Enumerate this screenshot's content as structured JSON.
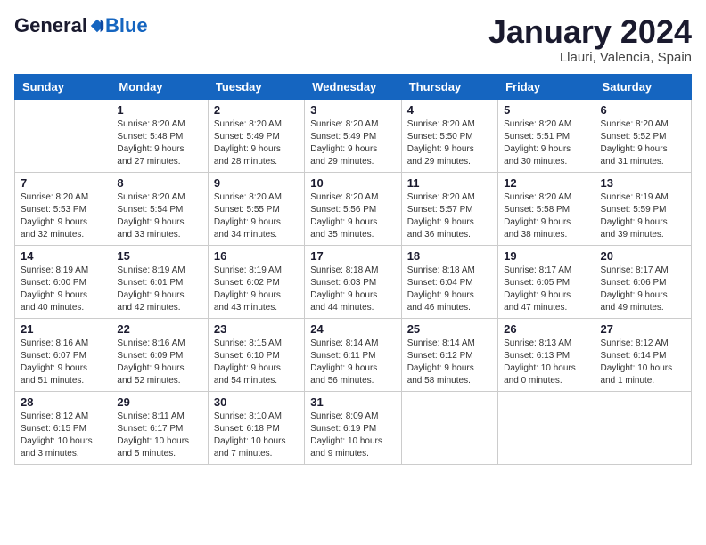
{
  "header": {
    "logo_general": "General",
    "logo_blue": "Blue",
    "month_title": "January 2024",
    "location": "Llauri, Valencia, Spain"
  },
  "days_of_week": [
    "Sunday",
    "Monday",
    "Tuesday",
    "Wednesday",
    "Thursday",
    "Friday",
    "Saturday"
  ],
  "weeks": [
    [
      {
        "day": "",
        "info": ""
      },
      {
        "day": "1",
        "info": "Sunrise: 8:20 AM\nSunset: 5:48 PM\nDaylight: 9 hours\nand 27 minutes."
      },
      {
        "day": "2",
        "info": "Sunrise: 8:20 AM\nSunset: 5:49 PM\nDaylight: 9 hours\nand 28 minutes."
      },
      {
        "day": "3",
        "info": "Sunrise: 8:20 AM\nSunset: 5:49 PM\nDaylight: 9 hours\nand 29 minutes."
      },
      {
        "day": "4",
        "info": "Sunrise: 8:20 AM\nSunset: 5:50 PM\nDaylight: 9 hours\nand 29 minutes."
      },
      {
        "day": "5",
        "info": "Sunrise: 8:20 AM\nSunset: 5:51 PM\nDaylight: 9 hours\nand 30 minutes."
      },
      {
        "day": "6",
        "info": "Sunrise: 8:20 AM\nSunset: 5:52 PM\nDaylight: 9 hours\nand 31 minutes."
      }
    ],
    [
      {
        "day": "7",
        "info": "Sunrise: 8:20 AM\nSunset: 5:53 PM\nDaylight: 9 hours\nand 32 minutes."
      },
      {
        "day": "8",
        "info": "Sunrise: 8:20 AM\nSunset: 5:54 PM\nDaylight: 9 hours\nand 33 minutes."
      },
      {
        "day": "9",
        "info": "Sunrise: 8:20 AM\nSunset: 5:55 PM\nDaylight: 9 hours\nand 34 minutes."
      },
      {
        "day": "10",
        "info": "Sunrise: 8:20 AM\nSunset: 5:56 PM\nDaylight: 9 hours\nand 35 minutes."
      },
      {
        "day": "11",
        "info": "Sunrise: 8:20 AM\nSunset: 5:57 PM\nDaylight: 9 hours\nand 36 minutes."
      },
      {
        "day": "12",
        "info": "Sunrise: 8:20 AM\nSunset: 5:58 PM\nDaylight: 9 hours\nand 38 minutes."
      },
      {
        "day": "13",
        "info": "Sunrise: 8:19 AM\nSunset: 5:59 PM\nDaylight: 9 hours\nand 39 minutes."
      }
    ],
    [
      {
        "day": "14",
        "info": "Sunrise: 8:19 AM\nSunset: 6:00 PM\nDaylight: 9 hours\nand 40 minutes."
      },
      {
        "day": "15",
        "info": "Sunrise: 8:19 AM\nSunset: 6:01 PM\nDaylight: 9 hours\nand 42 minutes."
      },
      {
        "day": "16",
        "info": "Sunrise: 8:19 AM\nSunset: 6:02 PM\nDaylight: 9 hours\nand 43 minutes."
      },
      {
        "day": "17",
        "info": "Sunrise: 8:18 AM\nSunset: 6:03 PM\nDaylight: 9 hours\nand 44 minutes."
      },
      {
        "day": "18",
        "info": "Sunrise: 8:18 AM\nSunset: 6:04 PM\nDaylight: 9 hours\nand 46 minutes."
      },
      {
        "day": "19",
        "info": "Sunrise: 8:17 AM\nSunset: 6:05 PM\nDaylight: 9 hours\nand 47 minutes."
      },
      {
        "day": "20",
        "info": "Sunrise: 8:17 AM\nSunset: 6:06 PM\nDaylight: 9 hours\nand 49 minutes."
      }
    ],
    [
      {
        "day": "21",
        "info": "Sunrise: 8:16 AM\nSunset: 6:07 PM\nDaylight: 9 hours\nand 51 minutes."
      },
      {
        "day": "22",
        "info": "Sunrise: 8:16 AM\nSunset: 6:09 PM\nDaylight: 9 hours\nand 52 minutes."
      },
      {
        "day": "23",
        "info": "Sunrise: 8:15 AM\nSunset: 6:10 PM\nDaylight: 9 hours\nand 54 minutes."
      },
      {
        "day": "24",
        "info": "Sunrise: 8:14 AM\nSunset: 6:11 PM\nDaylight: 9 hours\nand 56 minutes."
      },
      {
        "day": "25",
        "info": "Sunrise: 8:14 AM\nSunset: 6:12 PM\nDaylight: 9 hours\nand 58 minutes."
      },
      {
        "day": "26",
        "info": "Sunrise: 8:13 AM\nSunset: 6:13 PM\nDaylight: 10 hours\nand 0 minutes."
      },
      {
        "day": "27",
        "info": "Sunrise: 8:12 AM\nSunset: 6:14 PM\nDaylight: 10 hours\nand 1 minute."
      }
    ],
    [
      {
        "day": "28",
        "info": "Sunrise: 8:12 AM\nSunset: 6:15 PM\nDaylight: 10 hours\nand 3 minutes."
      },
      {
        "day": "29",
        "info": "Sunrise: 8:11 AM\nSunset: 6:17 PM\nDaylight: 10 hours\nand 5 minutes."
      },
      {
        "day": "30",
        "info": "Sunrise: 8:10 AM\nSunset: 6:18 PM\nDaylight: 10 hours\nand 7 minutes."
      },
      {
        "day": "31",
        "info": "Sunrise: 8:09 AM\nSunset: 6:19 PM\nDaylight: 10 hours\nand 9 minutes."
      },
      {
        "day": "",
        "info": ""
      },
      {
        "day": "",
        "info": ""
      },
      {
        "day": "",
        "info": ""
      }
    ]
  ]
}
